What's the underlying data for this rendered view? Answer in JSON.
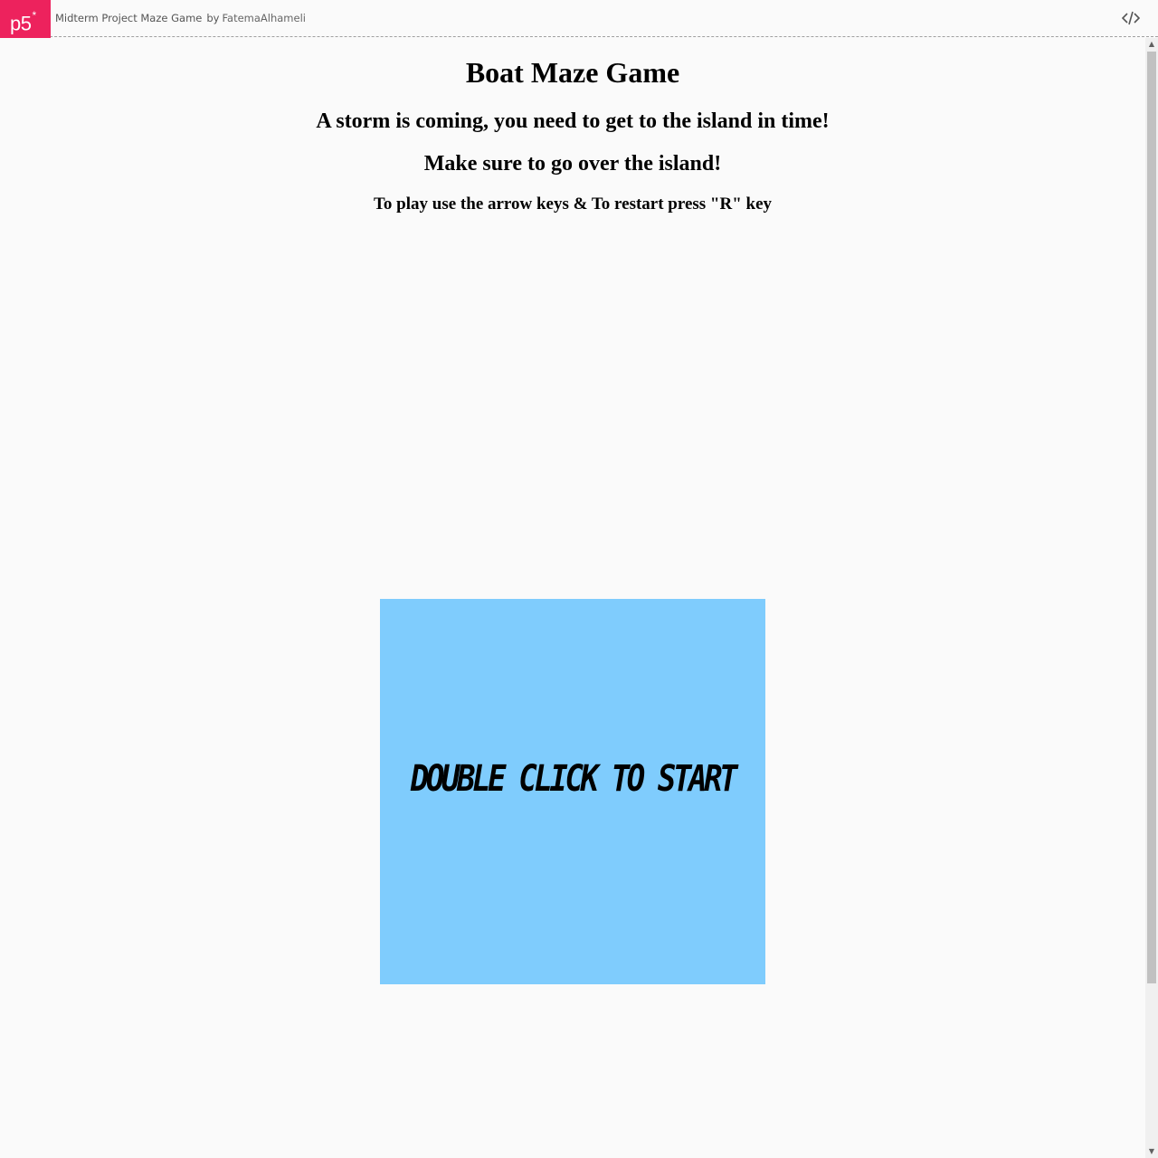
{
  "header": {
    "logo": "p5",
    "logo_mark": "*",
    "sketch_title": "Midterm Project Maze Game",
    "by": "by",
    "author": "FatemaAlhameli",
    "code_icon": "code-icon"
  },
  "page": {
    "title": "Boat Maze Game",
    "line1": "A storm is coming, you need to get to the island in time!",
    "line2": "Make sure to go over the island!",
    "instructions": "To play use the arrow keys & To restart press \"R\" key"
  },
  "game": {
    "start_prompt": "DOUBLE CLICK TO START",
    "background_color": "#7fccfd"
  },
  "colors": {
    "brand": "#ed225d",
    "page_background": "#fafafa"
  }
}
